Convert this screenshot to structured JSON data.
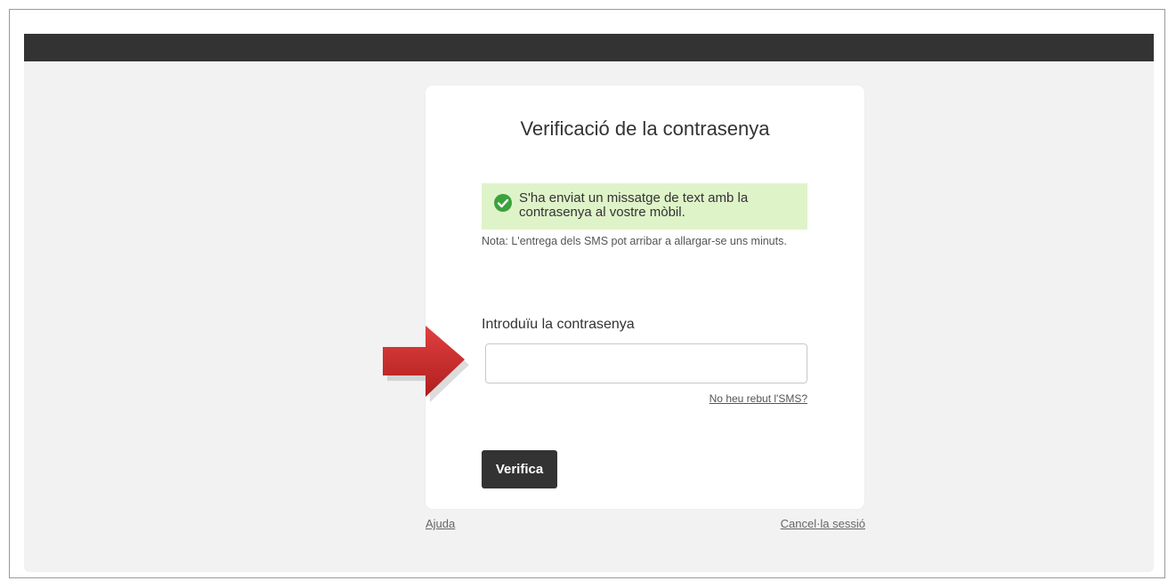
{
  "page": {
    "title": "Verificació de la contrasenya"
  },
  "alert": {
    "icon": "check-circle-icon",
    "color": "#dff3c9",
    "icon_color": "#3ca23c",
    "message": "S'ha enviat un missatge de text amb la contrasenya al vostre mòbil."
  },
  "note": "Nota: L'entrega dels SMS pot arribar a allargar-se uns minuts.",
  "form": {
    "password_label": "Introduïu la contrasenya",
    "password_value": "",
    "resend_link": "No heu rebut l'SMS?",
    "verify_button": "Verifica"
  },
  "footer": {
    "help_link": "Ajuda",
    "cancel_link": "Cancel·la sessió"
  },
  "annotation": {
    "arrow_icon": "red-arrow-right-icon",
    "arrow_color": "#c62828"
  },
  "colors": {
    "topbar": "#333333",
    "background": "#f2f2f2",
    "button": "#333333"
  }
}
